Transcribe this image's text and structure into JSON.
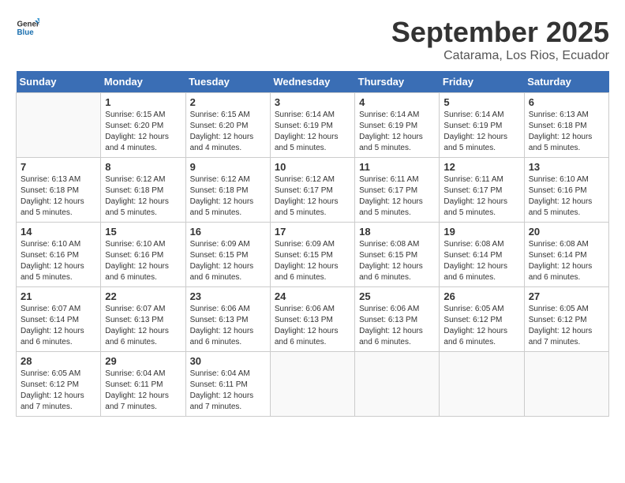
{
  "logo": {
    "line1": "General",
    "line2": "Blue"
  },
  "title": "September 2025",
  "subtitle": "Catarama, Los Rios, Ecuador",
  "days_of_week": [
    "Sunday",
    "Monday",
    "Tuesday",
    "Wednesday",
    "Thursday",
    "Friday",
    "Saturday"
  ],
  "weeks": [
    [
      {
        "day": "",
        "info": ""
      },
      {
        "day": "1",
        "info": "Sunrise: 6:15 AM\nSunset: 6:20 PM\nDaylight: 12 hours\nand 4 minutes."
      },
      {
        "day": "2",
        "info": "Sunrise: 6:15 AM\nSunset: 6:20 PM\nDaylight: 12 hours\nand 4 minutes."
      },
      {
        "day": "3",
        "info": "Sunrise: 6:14 AM\nSunset: 6:19 PM\nDaylight: 12 hours\nand 5 minutes."
      },
      {
        "day": "4",
        "info": "Sunrise: 6:14 AM\nSunset: 6:19 PM\nDaylight: 12 hours\nand 5 minutes."
      },
      {
        "day": "5",
        "info": "Sunrise: 6:14 AM\nSunset: 6:19 PM\nDaylight: 12 hours\nand 5 minutes."
      },
      {
        "day": "6",
        "info": "Sunrise: 6:13 AM\nSunset: 6:18 PM\nDaylight: 12 hours\nand 5 minutes."
      }
    ],
    [
      {
        "day": "7",
        "info": "Sunrise: 6:13 AM\nSunset: 6:18 PM\nDaylight: 12 hours\nand 5 minutes."
      },
      {
        "day": "8",
        "info": "Sunrise: 6:12 AM\nSunset: 6:18 PM\nDaylight: 12 hours\nand 5 minutes."
      },
      {
        "day": "9",
        "info": "Sunrise: 6:12 AM\nSunset: 6:18 PM\nDaylight: 12 hours\nand 5 minutes."
      },
      {
        "day": "10",
        "info": "Sunrise: 6:12 AM\nSunset: 6:17 PM\nDaylight: 12 hours\nand 5 minutes."
      },
      {
        "day": "11",
        "info": "Sunrise: 6:11 AM\nSunset: 6:17 PM\nDaylight: 12 hours\nand 5 minutes."
      },
      {
        "day": "12",
        "info": "Sunrise: 6:11 AM\nSunset: 6:17 PM\nDaylight: 12 hours\nand 5 minutes."
      },
      {
        "day": "13",
        "info": "Sunrise: 6:10 AM\nSunset: 6:16 PM\nDaylight: 12 hours\nand 5 minutes."
      }
    ],
    [
      {
        "day": "14",
        "info": "Sunrise: 6:10 AM\nSunset: 6:16 PM\nDaylight: 12 hours\nand 5 minutes."
      },
      {
        "day": "15",
        "info": "Sunrise: 6:10 AM\nSunset: 6:16 PM\nDaylight: 12 hours\nand 6 minutes."
      },
      {
        "day": "16",
        "info": "Sunrise: 6:09 AM\nSunset: 6:15 PM\nDaylight: 12 hours\nand 6 minutes."
      },
      {
        "day": "17",
        "info": "Sunrise: 6:09 AM\nSunset: 6:15 PM\nDaylight: 12 hours\nand 6 minutes."
      },
      {
        "day": "18",
        "info": "Sunrise: 6:08 AM\nSunset: 6:15 PM\nDaylight: 12 hours\nand 6 minutes."
      },
      {
        "day": "19",
        "info": "Sunrise: 6:08 AM\nSunset: 6:14 PM\nDaylight: 12 hours\nand 6 minutes."
      },
      {
        "day": "20",
        "info": "Sunrise: 6:08 AM\nSunset: 6:14 PM\nDaylight: 12 hours\nand 6 minutes."
      }
    ],
    [
      {
        "day": "21",
        "info": "Sunrise: 6:07 AM\nSunset: 6:14 PM\nDaylight: 12 hours\nand 6 minutes."
      },
      {
        "day": "22",
        "info": "Sunrise: 6:07 AM\nSunset: 6:13 PM\nDaylight: 12 hours\nand 6 minutes."
      },
      {
        "day": "23",
        "info": "Sunrise: 6:06 AM\nSunset: 6:13 PM\nDaylight: 12 hours\nand 6 minutes."
      },
      {
        "day": "24",
        "info": "Sunrise: 6:06 AM\nSunset: 6:13 PM\nDaylight: 12 hours\nand 6 minutes."
      },
      {
        "day": "25",
        "info": "Sunrise: 6:06 AM\nSunset: 6:13 PM\nDaylight: 12 hours\nand 6 minutes."
      },
      {
        "day": "26",
        "info": "Sunrise: 6:05 AM\nSunset: 6:12 PM\nDaylight: 12 hours\nand 6 minutes."
      },
      {
        "day": "27",
        "info": "Sunrise: 6:05 AM\nSunset: 6:12 PM\nDaylight: 12 hours\nand 7 minutes."
      }
    ],
    [
      {
        "day": "28",
        "info": "Sunrise: 6:05 AM\nSunset: 6:12 PM\nDaylight: 12 hours\nand 7 minutes."
      },
      {
        "day": "29",
        "info": "Sunrise: 6:04 AM\nSunset: 6:11 PM\nDaylight: 12 hours\nand 7 minutes."
      },
      {
        "day": "30",
        "info": "Sunrise: 6:04 AM\nSunset: 6:11 PM\nDaylight: 12 hours\nand 7 minutes."
      },
      {
        "day": "",
        "info": ""
      },
      {
        "day": "",
        "info": ""
      },
      {
        "day": "",
        "info": ""
      },
      {
        "day": "",
        "info": ""
      }
    ]
  ]
}
